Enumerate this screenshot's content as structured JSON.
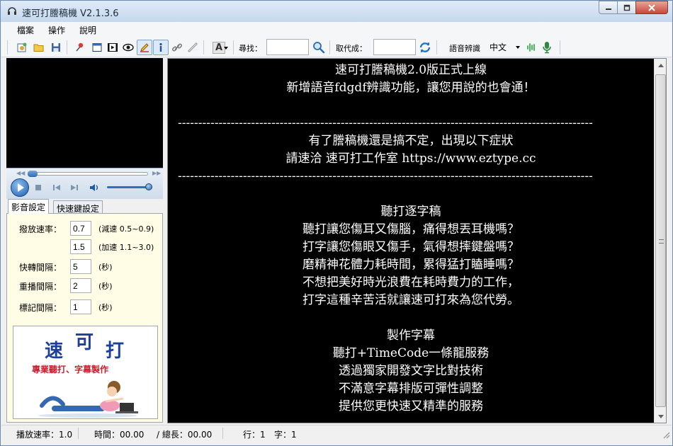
{
  "window": {
    "title": "速可打謄稿機 V2.1.3.6",
    "min_icon": "minimize-icon",
    "max_icon": "maximize-icon",
    "close_icon": "close-icon"
  },
  "menu": [
    "檔案",
    "操作",
    "說明"
  ],
  "toolbar": {
    "icons": [
      "new-project-icon",
      "open-folder-icon",
      "save-icon",
      "pin-icon",
      "window-icon",
      "video-icon",
      "eye-icon",
      "pen-icon",
      "info-icon",
      "link-icon",
      "ruler-icon",
      "font-icon"
    ],
    "font_label": "A",
    "find_label": "尋找：",
    "find_value": "",
    "replace_label": "取代成：",
    "replace_value": "",
    "voice_label": "語音辨識",
    "voice_lang": "中文",
    "accent_color": "#2b8a3e"
  },
  "player": {
    "progress": 0.0,
    "volume": 0.9
  },
  "settings_tabs": [
    "影音設定",
    "快速鍵設定"
  ],
  "settings": {
    "speed_label": "撥放速率：",
    "slow_value": "0.7",
    "slow_hint": "(減速 0.5~0.9)",
    "fast_value": "1.5",
    "fast_hint": "(加速 1.1~3.0)",
    "ff_label": "快轉間隔：",
    "ff_value": "5",
    "ff_unit": "(秒)",
    "replay_label": "重播間隔：",
    "replay_value": "2",
    "replay_unit": "(秒)",
    "mark_label": "標記間隔：",
    "mark_value": "1",
    "mark_unit": "(秒)"
  },
  "logo": {
    "c1": "速",
    "c2": "可",
    "c3": "打",
    "subtitle": "專業聽打、字幕製作"
  },
  "editor": {
    "lines": [
      "速可打謄稿機2.0版正式上線",
      "新增語音fdgdf辨識功能，讓您用說的也會通！",
      "",
      "------------------------------------------------------------------------------------------------------",
      "有了謄稿機還是搞不定，出現以下症狀",
      "請速洽 速可打工作室 https://www.eztype.cc",
      "------------------------------------------------------------------------------------------------------",
      "",
      "聽打逐字稿",
      "聽打讓您傷耳又傷腦，痛得想丟耳機嗎？",
      "打字讓您傷眼又傷手，氣得想摔鍵盤嗎？",
      "磨精神花體力耗時間，累得猛打瞌睡嗎？",
      "不想把美好時光浪費在耗時費力的工作，",
      "打字這種辛苦活就讓速可打來為您代勞。",
      "",
      "製作字幕",
      "聽打+TimeCode一條龍服務",
      "透過獨家開發文字比對技術",
      "不滿意字幕排版可彈性調整",
      "提供您更快速又精準的服務"
    ]
  },
  "status": {
    "speed": "播放速率：1.0",
    "time": "時間：00.00",
    "total": "/ 總長：00.00",
    "line": "行：1",
    "char": "字：1"
  }
}
